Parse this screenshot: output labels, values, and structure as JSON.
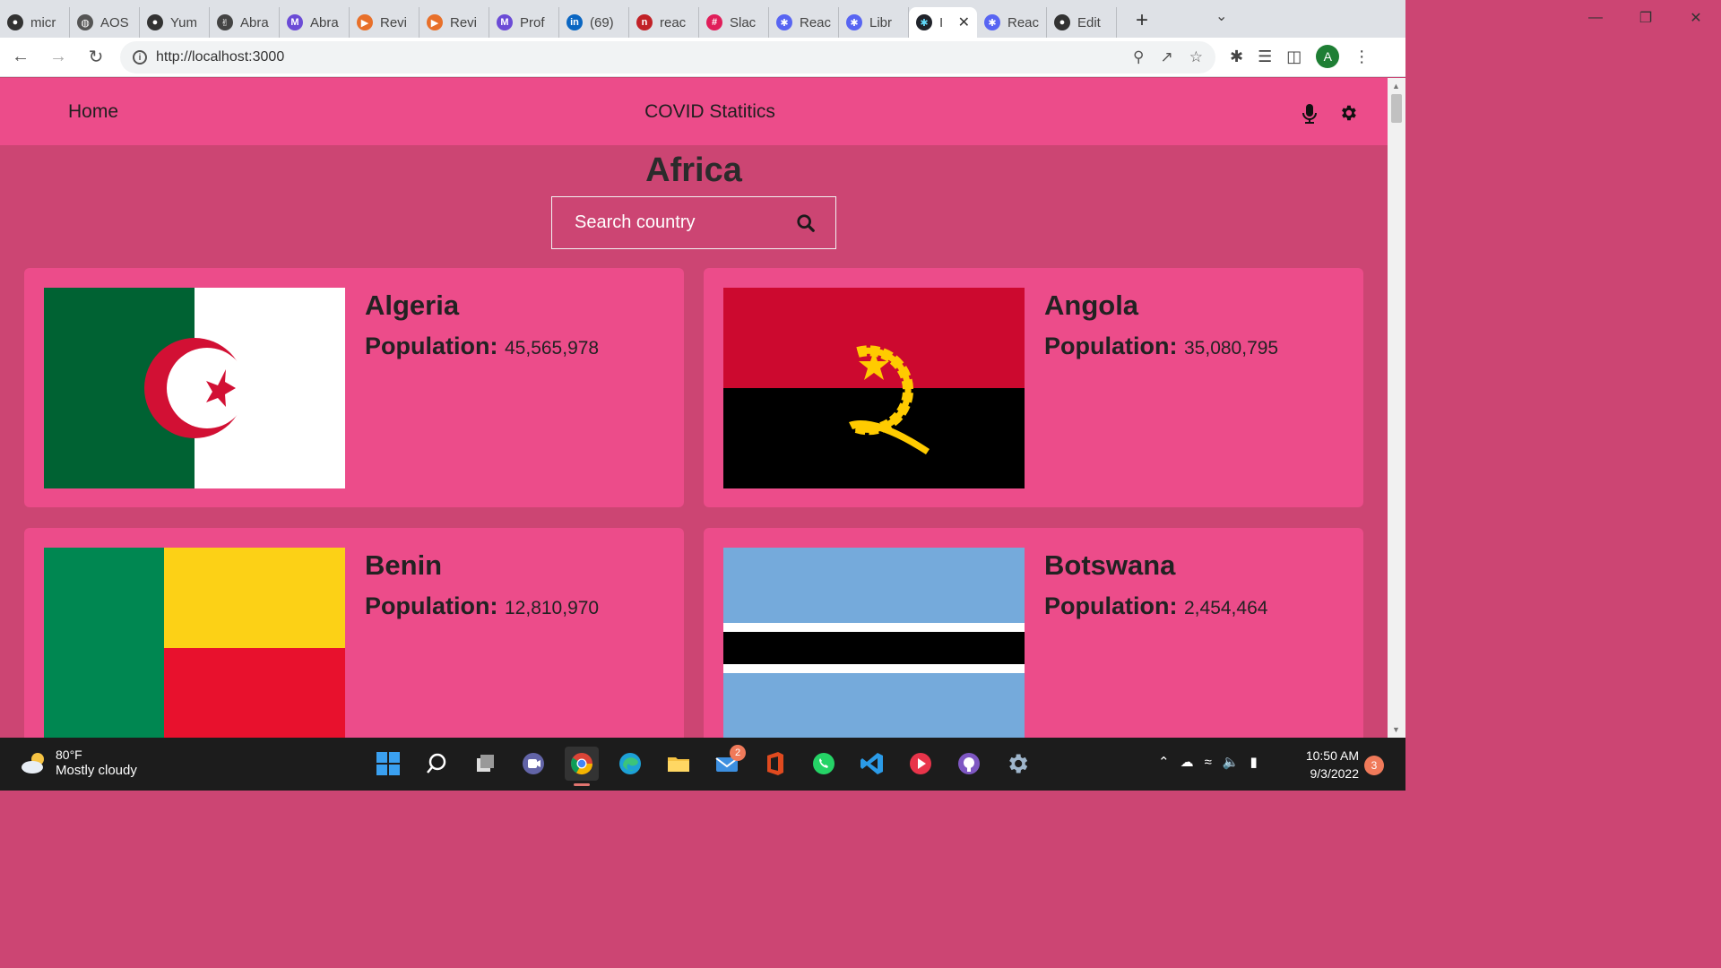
{
  "browser": {
    "tabs": [
      {
        "label": "micr",
        "icon": "github-icon",
        "color": "#333333"
      },
      {
        "label": "AOS",
        "icon": "globe-icon",
        "color": "#555555"
      },
      {
        "label": "Yum",
        "icon": "github-icon",
        "color": "#333333"
      },
      {
        "label": "Abra",
        "icon": "peace-icon",
        "color": "#444444"
      },
      {
        "label": "Abra",
        "icon": "abra-icon",
        "color": "#6b4bd6"
      },
      {
        "label": "Revi",
        "icon": "review-icon",
        "color": "#e8702a"
      },
      {
        "label": "Revi",
        "icon": "review-icon",
        "color": "#e8702a"
      },
      {
        "label": "Prof",
        "icon": "abra-icon",
        "color": "#6b4bd6"
      },
      {
        "label": "(69)",
        "icon": "linkedin-icon",
        "color": "#0a66c2"
      },
      {
        "label": "reac",
        "icon": "npm-icon",
        "color": "#c12127"
      },
      {
        "label": "Slac",
        "icon": "slack-icon",
        "color": "#e01e5a"
      },
      {
        "label": "Reac",
        "icon": "react-icon",
        "color": "#5865f2"
      },
      {
        "label": "Libr",
        "icon": "react-icon",
        "color": "#5865f2"
      }
    ],
    "active_tab": {
      "label": "I",
      "icon": "react-icon",
      "close": "✕"
    },
    "tabs_after": [
      {
        "label": "Reac",
        "icon": "react-icon",
        "color": "#5865f2"
      },
      {
        "label": "Edit",
        "icon": "github-icon",
        "color": "#333333"
      }
    ],
    "url": "http://localhost:3000",
    "profile_initial": "A"
  },
  "app": {
    "nav": {
      "home_label": "Home",
      "title": "COVID Statitics"
    },
    "region": "Africa",
    "search": {
      "placeholder": "Search country"
    },
    "population_label": "Population:",
    "countries": [
      {
        "name": "Algeria",
        "population": "45,565,978"
      },
      {
        "name": "Angola",
        "population": "35,080,795"
      },
      {
        "name": "Benin",
        "population": "12,810,970"
      },
      {
        "name": "Botswana",
        "population": "2,454,464"
      }
    ],
    "colors": {
      "nav": "#ec4c8a",
      "background": "#cc4573",
      "card": "#ec4c8a"
    }
  },
  "taskbar": {
    "weather_temp": "80°F",
    "weather_desc": "Mostly cloudy",
    "mail_badge": "2",
    "time": "10:50 AM",
    "date": "9/3/2022",
    "notifications": "3"
  }
}
